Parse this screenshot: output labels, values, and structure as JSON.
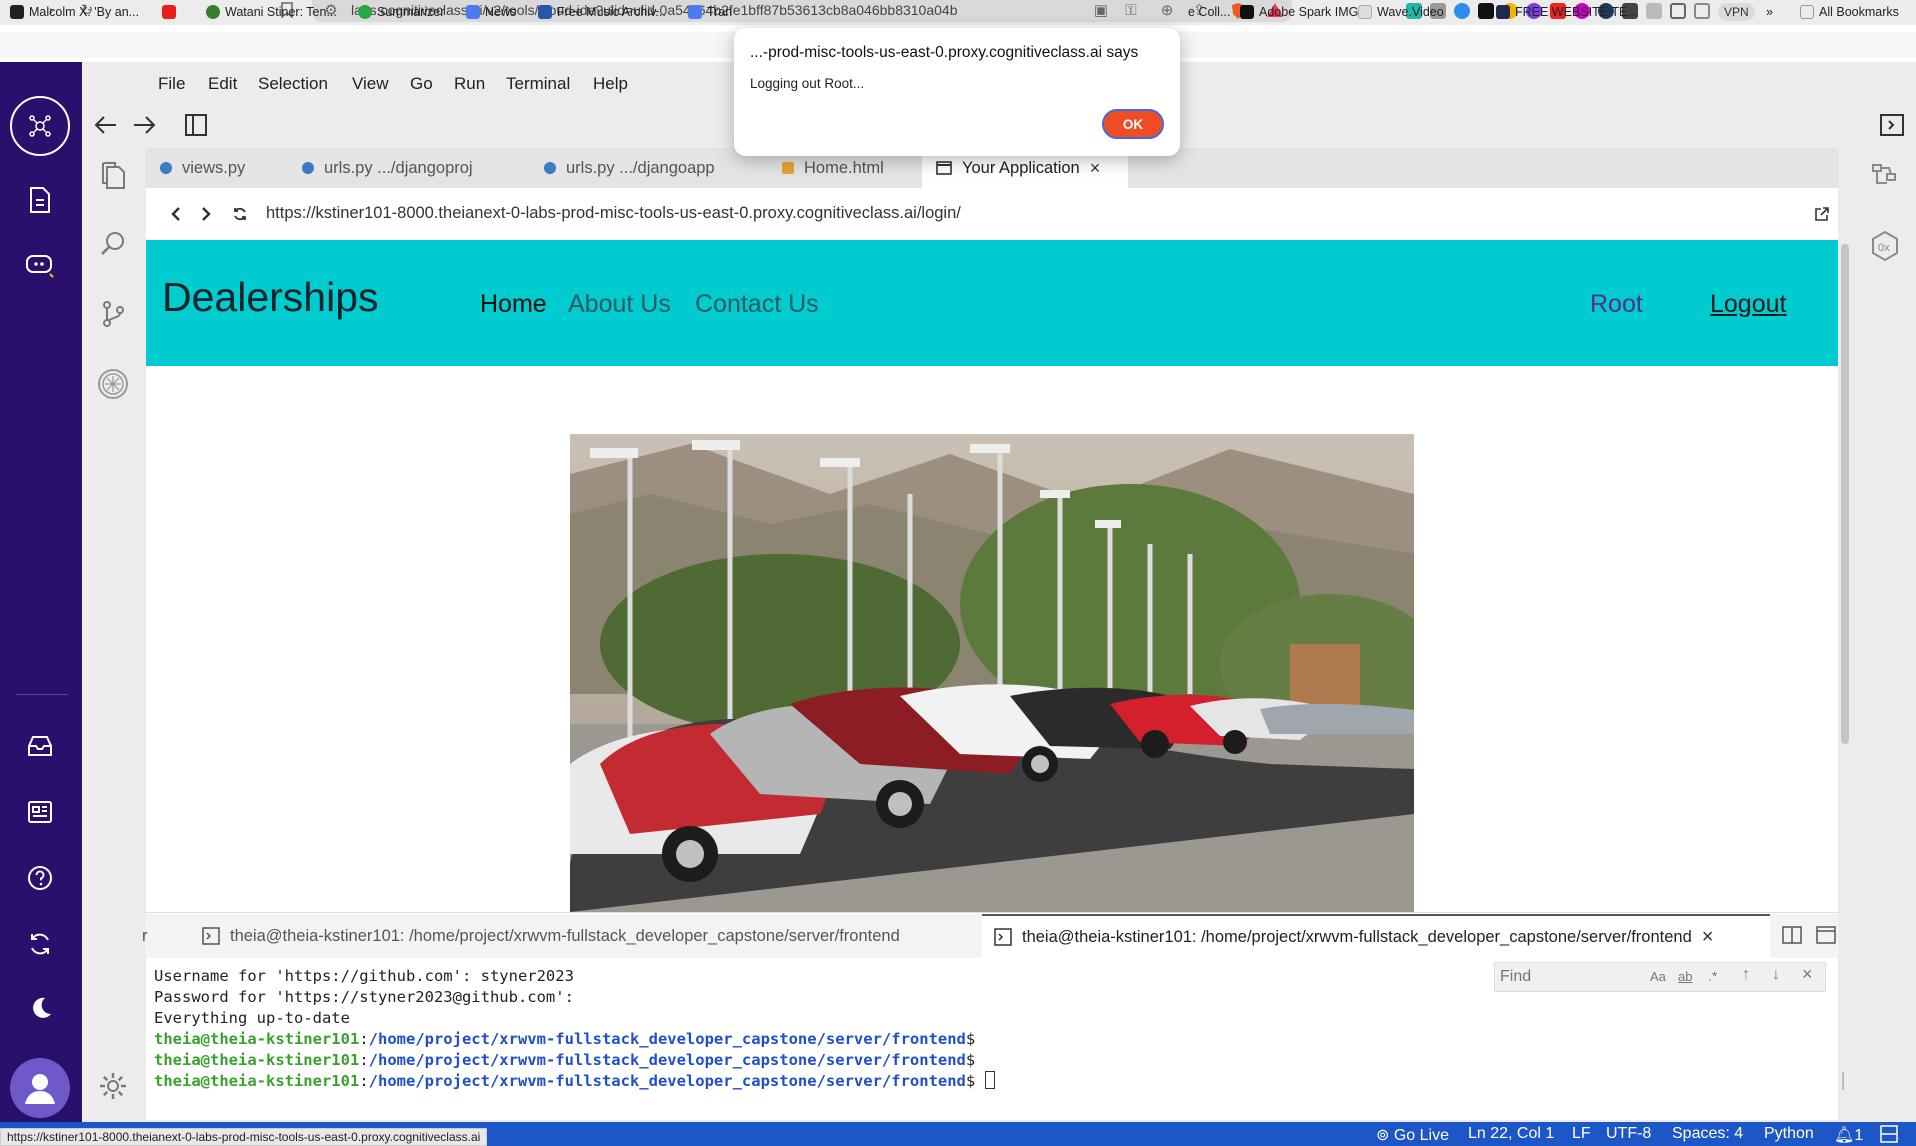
{
  "browser": {
    "url": "labs.cognitiveclass.ai/v2/tools/cloud-ide?ulid=ulid-0a54c64b2fe1bff87b53613cb8a046bb8310a04b",
    "vpn_label": "VPN",
    "bookmarks": [
      {
        "label": "Malcolm X: 'By an...",
        "color": "#222222"
      },
      {
        "label": "",
        "color": "#e62117"
      },
      {
        "label": "Watani Stiner: Ten...",
        "color": "#3b7d2e"
      },
      {
        "label": "Summarizer",
        "color": "#28a745"
      },
      {
        "label": "News",
        "color": "#4a7cf0"
      },
      {
        "label": "Free Music Archiv...",
        "color": "#2956a8"
      },
      {
        "label": "Tran",
        "color": "#4a7cf0"
      },
      {
        "label": "e Coll...",
        "color": "#ffffff"
      },
      {
        "label": "Adobe Spark IMG...",
        "color": "#111111"
      },
      {
        "label": "Wave.Video",
        "color": "#dddddd"
      },
      {
        "label": "FREE WEBSITE TE...",
        "color": "#1d2a4d"
      }
    ],
    "bookmarks_overflow": "»",
    "all_bookmarks": "All Bookmarks"
  },
  "ide": {
    "menu": [
      "File",
      "Edit",
      "Selection",
      "View",
      "Go",
      "Run",
      "Terminal",
      "Help"
    ],
    "tabs": [
      {
        "label": "views.py",
        "active": false
      },
      {
        "label": "urls.py .../djangoproj",
        "active": false
      },
      {
        "label": "urls.py .../djangoapp",
        "active": false
      },
      {
        "label": "Home.html",
        "active": false
      },
      {
        "label": "Your Application",
        "active": true
      }
    ]
  },
  "preview": {
    "url": "https://kstiner101-8000.theianext-0-labs-prod-misc-tools-us-east-0.proxy.cognitiveclass.ai/login/",
    "brand": "Dealerships",
    "nav": [
      "Home",
      "About Us",
      "Contact Us"
    ],
    "user": "Root",
    "logout": "Logout",
    "image_alt": "cars parked in a dealership lot"
  },
  "terminal": {
    "tab_partial": "r",
    "tab1": "theia@theia-kstiner101: /home/project/xrwvm-fullstack_developer_capstone/server/frontend",
    "tab2": "theia@theia-kstiner101: /home/project/xrwvm-fullstack_developer_capstone/server/frontend",
    "lines": [
      "Username for 'https://github.com': styner2023",
      "Password for 'https://styner2023@github.com':",
      "Everything up-to-date"
    ],
    "prompt_user": "theia@theia-kstiner101",
    "prompt_sep": ":",
    "prompt_path": "/home/project/xrwvm-fullstack_developer_capstone/server/frontend",
    "prompt_end": "$",
    "find_placeholder": "Find"
  },
  "status": {
    "go_live": "Go Live",
    "position": "Ln 22, Col 1",
    "eol": "LF",
    "encoding": "UTF-8",
    "spaces": "Spaces: 4",
    "language": "Python",
    "notifications": "1",
    "hover_link": "https://kstiner101-8000.theianext-0-labs-prod-misc-tools-us-east-0.proxy.cognitiveclass.ai"
  },
  "dialog": {
    "title": "...-prod-misc-tools-us-east-0.proxy.cognitiveclass.ai says",
    "message": "Logging out Root...",
    "ok": "OK"
  },
  "colors": {
    "rail": "#2b0f6d",
    "site_nav": "#00cbcf",
    "status_bar": "#1d57c7",
    "dialog_ok": "#ef4d25"
  }
}
